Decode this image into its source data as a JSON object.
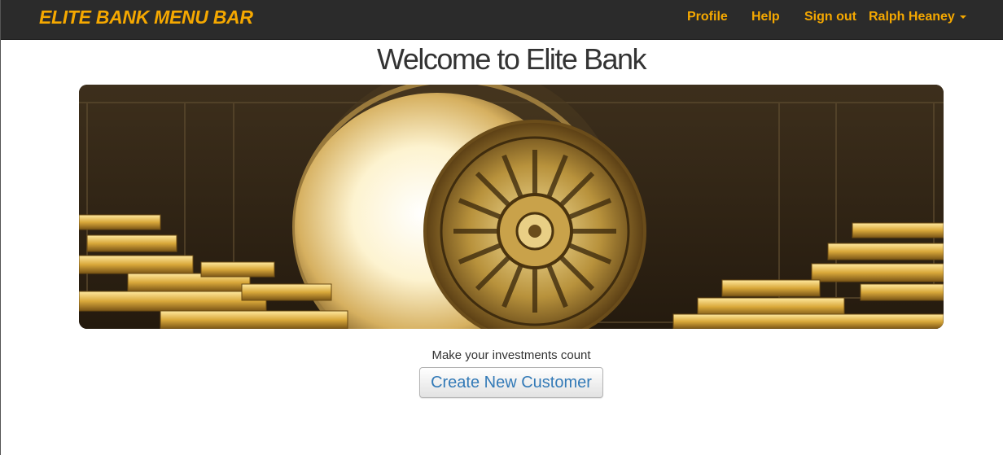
{
  "navbar": {
    "brand": "ELITE BANK MENU BAR",
    "links": {
      "profile": "Profile",
      "help": "Help",
      "sign_out": "Sign out",
      "user_menu": "Ralph Heaney"
    }
  },
  "main": {
    "title": "Welcome to Elite Bank",
    "tagline": "Make your investments count",
    "create_button_label": "Create New Customer"
  },
  "colors": {
    "navbar_bg": "#2b2b2b",
    "accent": "#f5a800",
    "link_blue": "#337ab7"
  },
  "icons": {
    "user_menu_caret": "caret-down-icon"
  }
}
